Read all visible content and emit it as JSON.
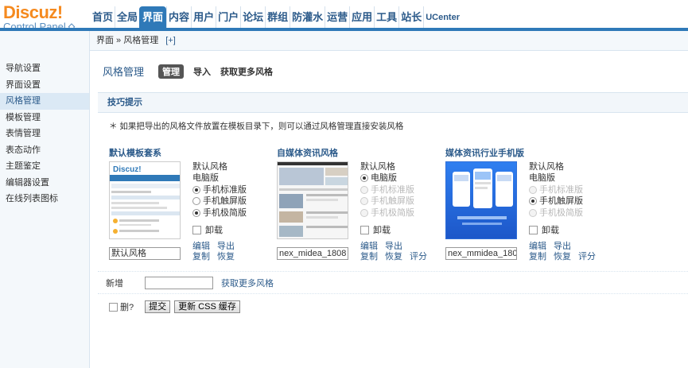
{
  "logo": {
    "title": "Discuz!",
    "subtitle": "Control Panel"
  },
  "nav": [
    "首页",
    "全局",
    "界面",
    "内容",
    "用户",
    "门户",
    "论坛",
    "群组",
    "防灌水",
    "运营",
    "应用",
    "工具",
    "站长",
    "UCenter"
  ],
  "nav_active": "界面",
  "breadcrumb": {
    "text": "界面 » 风格管理",
    "plus": "[+]"
  },
  "sidebar": [
    {
      "label": "导航设置",
      "active": false
    },
    {
      "label": "界面设置",
      "active": false
    },
    {
      "label": "风格管理",
      "active": true
    },
    {
      "label": "模板管理",
      "active": false
    },
    {
      "label": "表情管理",
      "active": false
    },
    {
      "label": "表态动作",
      "active": false
    },
    {
      "label": "主题鉴定",
      "active": false
    },
    {
      "label": "编辑器设置",
      "active": false
    },
    {
      "label": "在线列表图标",
      "active": false
    }
  ],
  "main": {
    "title": "风格管理",
    "tabs": [
      "管理",
      "导入",
      "获取更多风格"
    ],
    "tips_title": "技巧提示",
    "tip": "＊ 如果把导出的风格文件放置在模板目录下，则可以通过风格管理直接安装风格"
  },
  "styles": [
    {
      "title": "默认模板套系",
      "default_label": "默认风格",
      "options": [
        {
          "label": "电脑版",
          "checked": false,
          "disabled": false,
          "radio": false
        },
        {
          "label": "手机标准版",
          "checked": true,
          "disabled": false,
          "radio": true
        },
        {
          "label": "手机触屏版",
          "checked": false,
          "disabled": false,
          "radio": true
        },
        {
          "label": "手机极简版",
          "checked": true,
          "disabled": false,
          "radio": true
        }
      ],
      "uninstall": "卸载",
      "name_value": "默认风格",
      "actions": [
        [
          "编辑",
          "导出"
        ],
        [
          "复制",
          "恢复"
        ]
      ]
    },
    {
      "title": "自媒体资讯风格",
      "default_label": "默认风格",
      "options": [
        {
          "label": "电脑版",
          "checked": true,
          "disabled": false,
          "radio": true
        },
        {
          "label": "手机标准版",
          "checked": false,
          "disabled": true,
          "radio": true
        },
        {
          "label": "手机触屏版",
          "checked": false,
          "disabled": true,
          "radio": true
        },
        {
          "label": "手机极简版",
          "checked": false,
          "disabled": true,
          "radio": true
        }
      ],
      "uninstall": "卸载",
      "name_value": "nex_midea_1808",
      "actions": [
        [
          "编辑",
          "导出"
        ],
        [
          "复制",
          "恢复",
          "评分"
        ]
      ]
    },
    {
      "title": "媒体资讯行业手机版",
      "default_label": "默认风格",
      "options": [
        {
          "label": "电脑版",
          "checked": false,
          "disabled": false,
          "radio": false
        },
        {
          "label": "手机标准版",
          "checked": false,
          "disabled": true,
          "radio": true
        },
        {
          "label": "手机触屏版",
          "checked": true,
          "disabled": false,
          "radio": true
        },
        {
          "label": "手机极简版",
          "checked": false,
          "disabled": true,
          "radio": true
        }
      ],
      "uninstall": "卸载",
      "name_value": "nex_mmidea_180",
      "actions": [
        [
          "编辑",
          "导出"
        ],
        [
          "复制",
          "恢复",
          "评分"
        ]
      ]
    }
  ],
  "add": {
    "label": "新增",
    "link": "获取更多风格"
  },
  "submit": {
    "delete_label": "删?",
    "submit_label": "提交",
    "refresh_label": "更新 CSS 缓存"
  },
  "colors": {
    "brand_orange": "#f58a1f",
    "nav_blue": "#2f79b8",
    "link_blue": "#2b5a8a"
  }
}
